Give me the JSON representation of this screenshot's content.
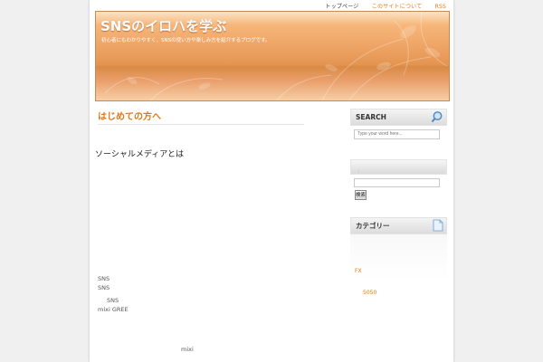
{
  "topnav": {
    "items": [
      "トップページ",
      "このサイトについて",
      "RSS"
    ]
  },
  "header": {
    "site_title": "SNSのイロハを学ぶ",
    "site_desc": "初心者にもわかりやすく、SNSの使い方や楽しみ方を紹介するブログです。"
  },
  "post": {
    "title": "はじめての方へ",
    "heading": "ソーシャルメディアとは",
    "lines": [
      "SNS",
      "SNS",
      "SNS",
      "mixi GREE",
      "mixi"
    ]
  },
  "sidebar": {
    "search": {
      "title": "SEARCH",
      "placeholder": "Type your word here..."
    },
    "widget2": {
      "label": "：",
      "button": "検索"
    },
    "widget3": {
      "title": "カテゴリー",
      "links": [
        "FX",
        "5050"
      ]
    }
  },
  "colors": {
    "accent": "#e07a18",
    "header_orange": "#e39450"
  }
}
